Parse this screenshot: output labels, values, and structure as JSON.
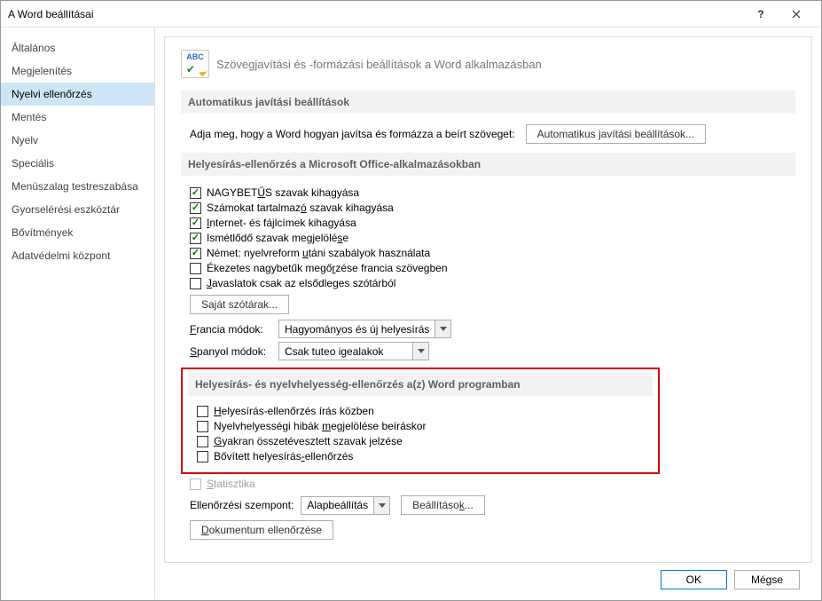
{
  "title": "A Word beállításai",
  "titlebar": {
    "help": "?",
    "close": "×"
  },
  "sidebar": {
    "items": [
      {
        "label": "Általános"
      },
      {
        "label": "Megjelenítés"
      },
      {
        "label": "Nyelvi ellenőrzés"
      },
      {
        "label": "Mentés"
      },
      {
        "label": "Nyelv"
      },
      {
        "label": "Speciális"
      },
      {
        "label": "Menüszalag testreszabása"
      },
      {
        "label": "Gyorselérési eszköztár"
      },
      {
        "label": "Bővítmények"
      },
      {
        "label": "Adatvédelmi központ"
      }
    ],
    "selected_index": 2
  },
  "header": {
    "icon_text": "ABC",
    "text": "Szövegjavítási és -formázási beállítások a Word alkalmazásban"
  },
  "autocorrect_section": {
    "title": "Automatikus javítási beállítások",
    "desc": "Adja meg, hogy a Word hogyan javítsa és formázza a beírt szöveget:",
    "button": "Automatikus javítási beállítások..."
  },
  "office_spell_section": {
    "title": "Helyesírás-ellenőrzés a Microsoft Office-alkalmazásokban",
    "checks": [
      {
        "label_pre": "NAGYBET",
        "label_u": "Ű",
        "label_post": "S szavak kihagyása",
        "checked": true
      },
      {
        "label_pre": "Számokat tartalmaz",
        "label_u": "ó",
        "label_post": " szavak kihagyása",
        "checked": true
      },
      {
        "label_pre": "",
        "label_u": "I",
        "label_post": "nternet- és fájlcímek kihagyása",
        "checked": true
      },
      {
        "label_pre": "Ismétlődő szavak megjelölé",
        "label_u": "s",
        "label_post": "e",
        "checked": true
      },
      {
        "label_pre": "Német: nyelvreform ",
        "label_u": "u",
        "label_post": "táni szabályok használata",
        "checked": true
      },
      {
        "label_pre": "Ékezetes nagybetűk megő",
        "label_u": "r",
        "label_post": "zése francia szövegben",
        "checked": false
      },
      {
        "label_pre": "",
        "label_u": "J",
        "label_post": "avaslatok csak az elsődleges szótárból",
        "checked": false
      }
    ],
    "dict_button": "Saját szótárak...",
    "french_label_pre": "",
    "french_label_u": "F",
    "french_label_post": "rancia módok:",
    "french_value": "Hagyományos és új helyesírás",
    "spanish_label_pre": "",
    "spanish_label_u": "S",
    "spanish_label_post": "panyol módok:",
    "spanish_value": "Csak tuteo igealakok"
  },
  "word_spell_section": {
    "title": "Helyesírás- és nyelvhelyesség-ellenőrzés a(z) Word programban",
    "checks": [
      {
        "label_pre": "",
        "label_u": "H",
        "label_post": "elyesírás-ellenőrzés írás közben"
      },
      {
        "label_pre": "Nyelvhelyességi hibák ",
        "label_u": "m",
        "label_post": "egjelölése beíráskor"
      },
      {
        "label_pre": "",
        "label_u": "G",
        "label_post": "yakran összetévesztett szavak jelzése"
      },
      {
        "label_pre": "Bővített helyesírás",
        "label_u": "-",
        "label_post": "ellenőrzés"
      }
    ],
    "stat_label_pre": "",
    "stat_label_u": "S",
    "stat_label_post": "tatisztika",
    "writing_style_label": "Ellenőrzési szempont:",
    "writing_style_value": "Alapbeállítás",
    "settings_button_pre": "Beállításo",
    "settings_button_u": "k",
    "settings_button_post": "...",
    "recheck_button_pre": "",
    "recheck_button_u": "D",
    "recheck_button_post": "okumentum ellenőrzése"
  },
  "footer": {
    "ok": "OK",
    "cancel": "Mégse"
  }
}
